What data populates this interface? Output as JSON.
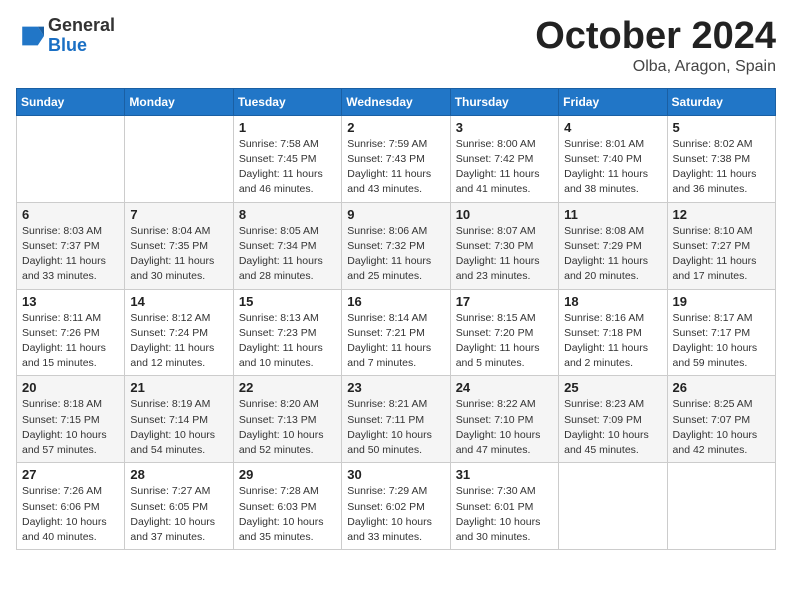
{
  "header": {
    "logo_general": "General",
    "logo_blue": "Blue",
    "month_title": "October 2024",
    "location": "Olba, Aragon, Spain"
  },
  "weekdays": [
    "Sunday",
    "Monday",
    "Tuesday",
    "Wednesday",
    "Thursday",
    "Friday",
    "Saturday"
  ],
  "weeks": [
    [
      null,
      null,
      {
        "day": "1",
        "sunrise": "Sunrise: 7:58 AM",
        "sunset": "Sunset: 7:45 PM",
        "daylight": "Daylight: 11 hours and 46 minutes."
      },
      {
        "day": "2",
        "sunrise": "Sunrise: 7:59 AM",
        "sunset": "Sunset: 7:43 PM",
        "daylight": "Daylight: 11 hours and 43 minutes."
      },
      {
        "day": "3",
        "sunrise": "Sunrise: 8:00 AM",
        "sunset": "Sunset: 7:42 PM",
        "daylight": "Daylight: 11 hours and 41 minutes."
      },
      {
        "day": "4",
        "sunrise": "Sunrise: 8:01 AM",
        "sunset": "Sunset: 7:40 PM",
        "daylight": "Daylight: 11 hours and 38 minutes."
      },
      {
        "day": "5",
        "sunrise": "Sunrise: 8:02 AM",
        "sunset": "Sunset: 7:38 PM",
        "daylight": "Daylight: 11 hours and 36 minutes."
      }
    ],
    [
      {
        "day": "6",
        "sunrise": "Sunrise: 8:03 AM",
        "sunset": "Sunset: 7:37 PM",
        "daylight": "Daylight: 11 hours and 33 minutes."
      },
      {
        "day": "7",
        "sunrise": "Sunrise: 8:04 AM",
        "sunset": "Sunset: 7:35 PM",
        "daylight": "Daylight: 11 hours and 30 minutes."
      },
      {
        "day": "8",
        "sunrise": "Sunrise: 8:05 AM",
        "sunset": "Sunset: 7:34 PM",
        "daylight": "Daylight: 11 hours and 28 minutes."
      },
      {
        "day": "9",
        "sunrise": "Sunrise: 8:06 AM",
        "sunset": "Sunset: 7:32 PM",
        "daylight": "Daylight: 11 hours and 25 minutes."
      },
      {
        "day": "10",
        "sunrise": "Sunrise: 8:07 AM",
        "sunset": "Sunset: 7:30 PM",
        "daylight": "Daylight: 11 hours and 23 minutes."
      },
      {
        "day": "11",
        "sunrise": "Sunrise: 8:08 AM",
        "sunset": "Sunset: 7:29 PM",
        "daylight": "Daylight: 11 hours and 20 minutes."
      },
      {
        "day": "12",
        "sunrise": "Sunrise: 8:10 AM",
        "sunset": "Sunset: 7:27 PM",
        "daylight": "Daylight: 11 hours and 17 minutes."
      }
    ],
    [
      {
        "day": "13",
        "sunrise": "Sunrise: 8:11 AM",
        "sunset": "Sunset: 7:26 PM",
        "daylight": "Daylight: 11 hours and 15 minutes."
      },
      {
        "day": "14",
        "sunrise": "Sunrise: 8:12 AM",
        "sunset": "Sunset: 7:24 PM",
        "daylight": "Daylight: 11 hours and 12 minutes."
      },
      {
        "day": "15",
        "sunrise": "Sunrise: 8:13 AM",
        "sunset": "Sunset: 7:23 PM",
        "daylight": "Daylight: 11 hours and 10 minutes."
      },
      {
        "day": "16",
        "sunrise": "Sunrise: 8:14 AM",
        "sunset": "Sunset: 7:21 PM",
        "daylight": "Daylight: 11 hours and 7 minutes."
      },
      {
        "day": "17",
        "sunrise": "Sunrise: 8:15 AM",
        "sunset": "Sunset: 7:20 PM",
        "daylight": "Daylight: 11 hours and 5 minutes."
      },
      {
        "day": "18",
        "sunrise": "Sunrise: 8:16 AM",
        "sunset": "Sunset: 7:18 PM",
        "daylight": "Daylight: 11 hours and 2 minutes."
      },
      {
        "day": "19",
        "sunrise": "Sunrise: 8:17 AM",
        "sunset": "Sunset: 7:17 PM",
        "daylight": "Daylight: 10 hours and 59 minutes."
      }
    ],
    [
      {
        "day": "20",
        "sunrise": "Sunrise: 8:18 AM",
        "sunset": "Sunset: 7:15 PM",
        "daylight": "Daylight: 10 hours and 57 minutes."
      },
      {
        "day": "21",
        "sunrise": "Sunrise: 8:19 AM",
        "sunset": "Sunset: 7:14 PM",
        "daylight": "Daylight: 10 hours and 54 minutes."
      },
      {
        "day": "22",
        "sunrise": "Sunrise: 8:20 AM",
        "sunset": "Sunset: 7:13 PM",
        "daylight": "Daylight: 10 hours and 52 minutes."
      },
      {
        "day": "23",
        "sunrise": "Sunrise: 8:21 AM",
        "sunset": "Sunset: 7:11 PM",
        "daylight": "Daylight: 10 hours and 50 minutes."
      },
      {
        "day": "24",
        "sunrise": "Sunrise: 8:22 AM",
        "sunset": "Sunset: 7:10 PM",
        "daylight": "Daylight: 10 hours and 47 minutes."
      },
      {
        "day": "25",
        "sunrise": "Sunrise: 8:23 AM",
        "sunset": "Sunset: 7:09 PM",
        "daylight": "Daylight: 10 hours and 45 minutes."
      },
      {
        "day": "26",
        "sunrise": "Sunrise: 8:25 AM",
        "sunset": "Sunset: 7:07 PM",
        "daylight": "Daylight: 10 hours and 42 minutes."
      }
    ],
    [
      {
        "day": "27",
        "sunrise": "Sunrise: 7:26 AM",
        "sunset": "Sunset: 6:06 PM",
        "daylight": "Daylight: 10 hours and 40 minutes."
      },
      {
        "day": "28",
        "sunrise": "Sunrise: 7:27 AM",
        "sunset": "Sunset: 6:05 PM",
        "daylight": "Daylight: 10 hours and 37 minutes."
      },
      {
        "day": "29",
        "sunrise": "Sunrise: 7:28 AM",
        "sunset": "Sunset: 6:03 PM",
        "daylight": "Daylight: 10 hours and 35 minutes."
      },
      {
        "day": "30",
        "sunrise": "Sunrise: 7:29 AM",
        "sunset": "Sunset: 6:02 PM",
        "daylight": "Daylight: 10 hours and 33 minutes."
      },
      {
        "day": "31",
        "sunrise": "Sunrise: 7:30 AM",
        "sunset": "Sunset: 6:01 PM",
        "daylight": "Daylight: 10 hours and 30 minutes."
      },
      null,
      null
    ]
  ]
}
